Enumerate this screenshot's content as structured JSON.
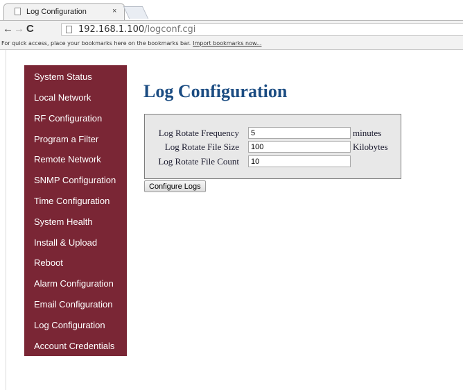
{
  "browser": {
    "tab_title": "Log Configuration",
    "tab_close": "×",
    "url_host": "192.168.1.100",
    "url_path": "/logconf.cgi",
    "bookmarks_message": "For quick access, place your bookmarks here on the bookmarks bar.",
    "bookmarks_link": "Import bookmarks now..."
  },
  "sidebar": {
    "items": [
      {
        "label": "System Status"
      },
      {
        "label": "Local Network"
      },
      {
        "label": "RF Configuration"
      },
      {
        "label": "Program a Filter"
      },
      {
        "label": "Remote Network"
      },
      {
        "label": "SNMP Configuration"
      },
      {
        "label": "Time Configuration"
      },
      {
        "label": "System Health"
      },
      {
        "label": "Install & Upload"
      },
      {
        "label": "Reboot"
      },
      {
        "label": "Alarm Configuration"
      },
      {
        "label": "Email Configuration"
      },
      {
        "label": "Log Configuration"
      },
      {
        "label": "Account Credentials"
      }
    ]
  },
  "page": {
    "title": "Log Configuration"
  },
  "form": {
    "rotate_frequency": {
      "label": "Log Rotate Frequency",
      "value": "5",
      "unit": "minutes"
    },
    "rotate_file_size": {
      "label": "Log Rotate File Size",
      "value": "100",
      "unit": "Kilobytes"
    },
    "rotate_file_count": {
      "label": "Log Rotate File Count",
      "value": "10"
    },
    "submit_label": "Configure Logs"
  },
  "colors": {
    "sidebar_bg": "#7a2635",
    "heading": "#1b4c82"
  }
}
